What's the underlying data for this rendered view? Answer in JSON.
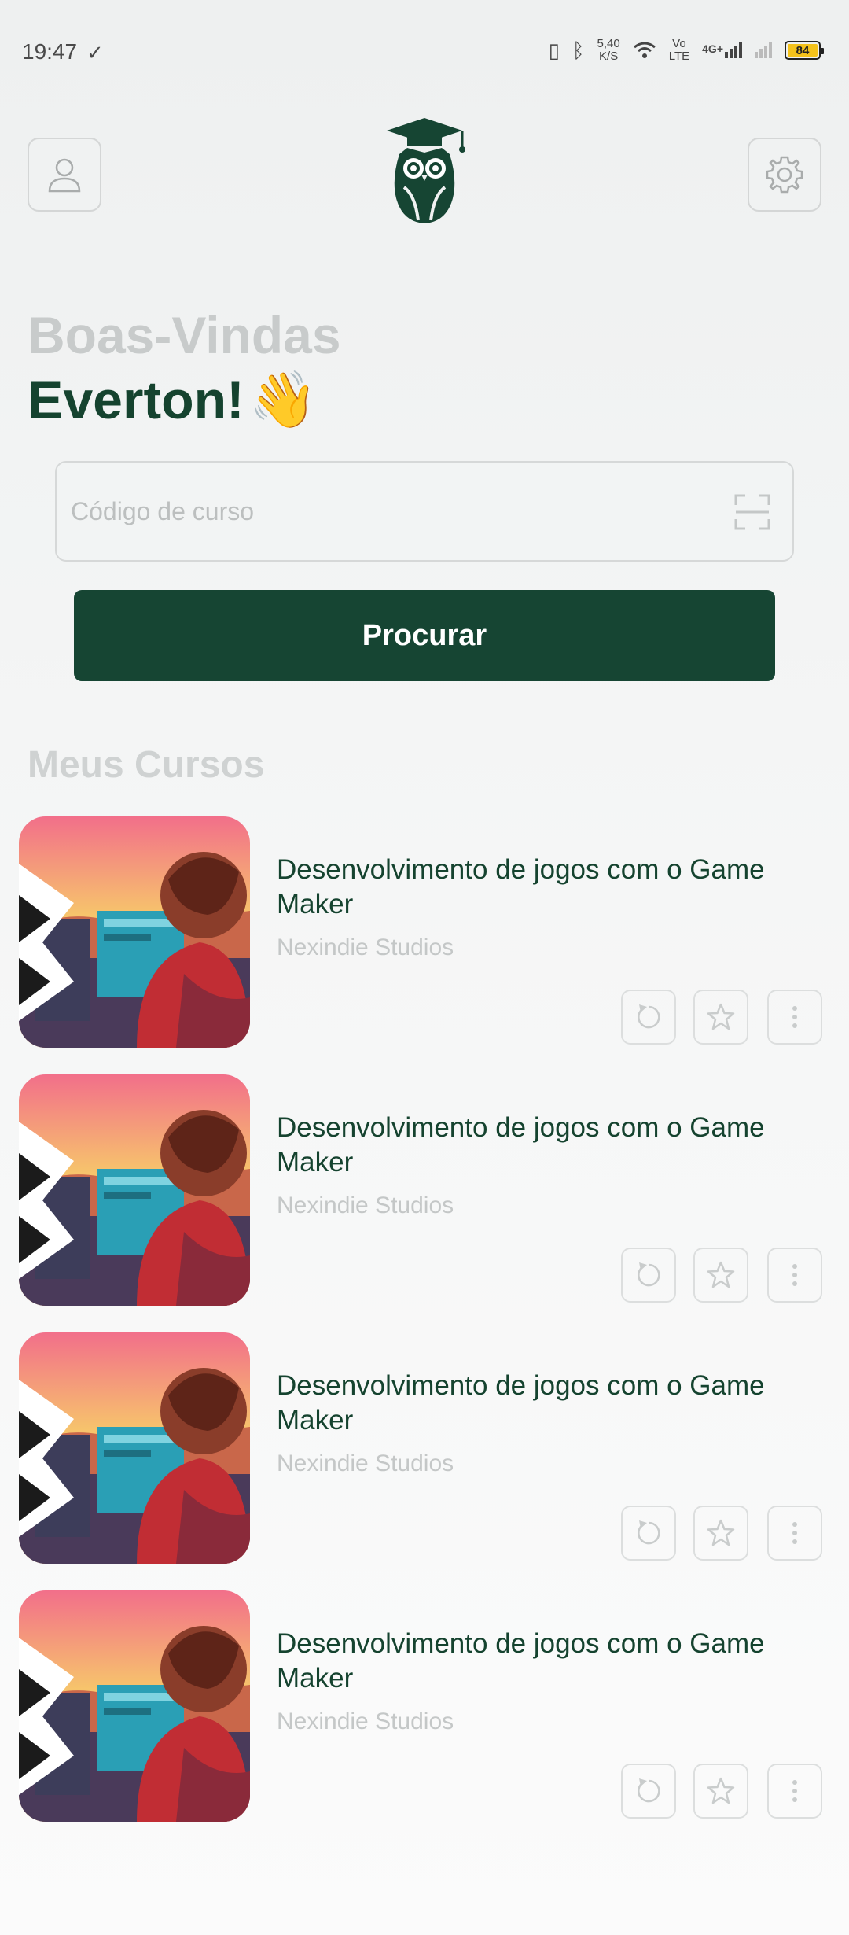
{
  "status_bar": {
    "time": "19:47",
    "left_icon": "download-done-icon",
    "speed_value": "5,40",
    "speed_unit": "K/S",
    "volte_top": "Vo",
    "volte_bottom": "LTE",
    "network": "4G+",
    "battery": "84"
  },
  "header": {
    "profile_icon": "user-icon",
    "logo_icon": "owl-graduation-logo",
    "settings_icon": "gear-icon"
  },
  "welcome": {
    "greeting": "Boas-Vindas",
    "name": "Everton!",
    "emoji": "👋"
  },
  "search": {
    "placeholder": "Código de curso",
    "value": "",
    "scan_icon": "scan-icon",
    "button_label": "Procurar"
  },
  "courses_section": {
    "title": "Meus Cursos"
  },
  "courses": [
    {
      "title": "Desenvolvimento de jogos com o Game Maker",
      "author": "Nexindie Studios"
    },
    {
      "title": "Desenvolvimento de jogos com o Game Maker",
      "author": "Nexindie Studios"
    },
    {
      "title": "Desenvolvimento de jogos com o Game Maker",
      "author": "Nexindie Studios"
    },
    {
      "title": "Desenvolvimento de jogos com o Game Maker",
      "author": "Nexindie Studios"
    }
  ],
  "colors": {
    "brand": "#164533",
    "muted_text": "#c8cbcb",
    "battery": "#f4c21b"
  }
}
